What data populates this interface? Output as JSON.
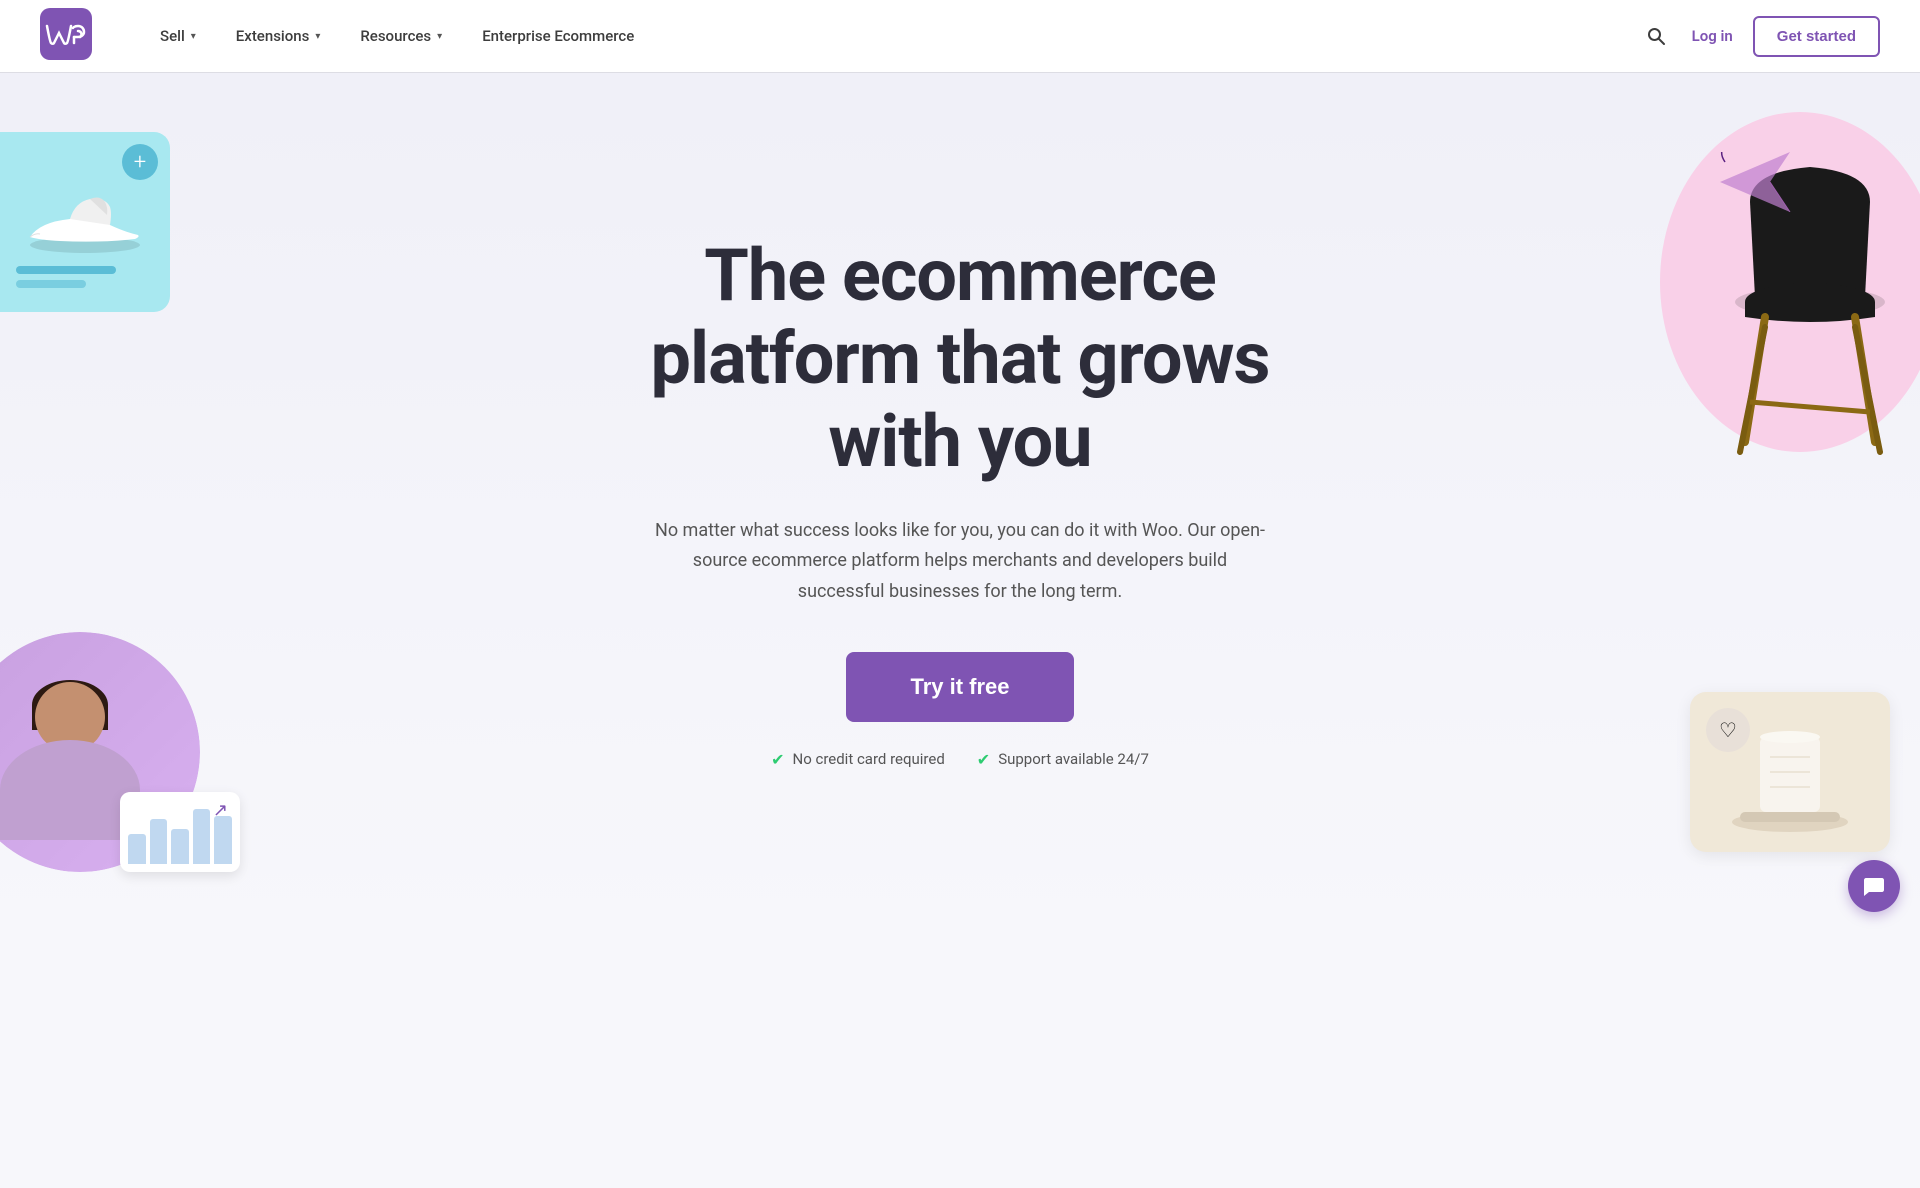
{
  "nav": {
    "logo_alt": "WooCommerce",
    "links": [
      {
        "label": "Sell",
        "has_dropdown": true
      },
      {
        "label": "Extensions",
        "has_dropdown": true
      },
      {
        "label": "Resources",
        "has_dropdown": true
      },
      {
        "label": "Enterprise Ecommerce",
        "has_dropdown": false
      }
    ],
    "login_label": "Log in",
    "get_started_label": "Get started",
    "search_aria": "Search"
  },
  "hero": {
    "title": "The ecommerce platform that grows with you",
    "subtitle": "No matter what success looks like for you, you can do it with Woo. Our open-source ecommerce platform helps merchants and developers build successful businesses for the long term.",
    "cta_label": "Try it free",
    "badge1": "No credit card required",
    "badge2": "Support available 24/7"
  },
  "colors": {
    "brand_purple": "#7f54b3",
    "teal": "#a8e8f0",
    "pink": "#f9d0e8",
    "beige": "#f0e8d8"
  },
  "chat": {
    "icon": "💬"
  }
}
